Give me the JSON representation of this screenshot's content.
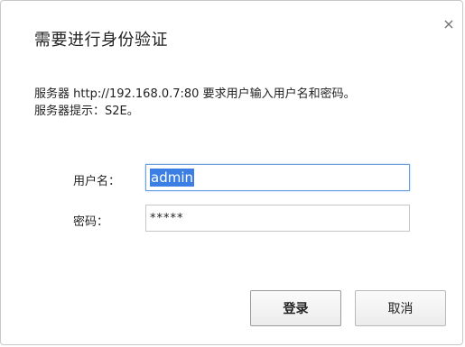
{
  "dialog": {
    "title": "需要进行身份验证",
    "close_glyph": "×"
  },
  "message": {
    "line1": "服务器 http://192.168.0.7:80 要求用户输入用户名和密码。",
    "line2": "服务器提示：S2E。"
  },
  "form": {
    "username_label": "用户名：",
    "username_value": "admin",
    "password_label": "密码：",
    "password_value": "*****"
  },
  "buttons": {
    "login_label": "登录",
    "cancel_label": "取消"
  },
  "colors": {
    "focus_border": "#6a9fe0",
    "selection": "#3b7ee4"
  },
  "icons": {
    "close": "close-icon"
  }
}
